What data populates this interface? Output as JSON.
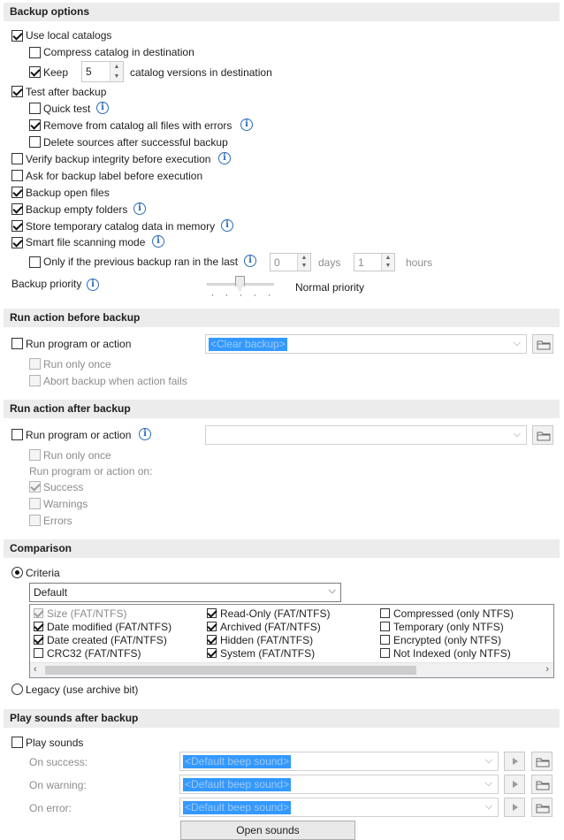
{
  "backup_options": {
    "header": "Backup options",
    "use_local_catalogs": {
      "label": "Use local catalogs",
      "checked": true
    },
    "compress_catalog": {
      "label": "Compress catalog in destination",
      "checked": false
    },
    "keep": {
      "label": "Keep",
      "value": "5",
      "suffix": "catalog versions in destination",
      "checked": true
    },
    "test_after_backup": {
      "label": "Test after backup",
      "checked": true
    },
    "quick_test": {
      "label": "Quick test",
      "checked": false
    },
    "remove_from_catalog": {
      "label": "Remove from catalog all files with errors",
      "checked": true
    },
    "delete_sources": {
      "label": "Delete sources after successful backup",
      "checked": false
    },
    "verify_integrity": {
      "label": "Verify backup integrity before execution",
      "checked": false
    },
    "ask_label": {
      "label": "Ask for backup label before execution",
      "checked": false
    },
    "backup_open_files": {
      "label": "Backup open files",
      "checked": true
    },
    "backup_empty_folders": {
      "label": "Backup empty folders",
      "checked": true
    },
    "store_temp": {
      "label": "Store temporary catalog data in memory",
      "checked": true
    },
    "smart_scan": {
      "label": "Smart file scanning mode",
      "checked": true
    },
    "only_if_previous": {
      "label": "Only if the previous backup ran in the last",
      "days_value": "0",
      "days_label": "days",
      "hours_value": "1",
      "hours_label": "hours",
      "checked": false
    },
    "priority": {
      "label": "Backup priority",
      "value_label": "Normal priority",
      "level": 0.5
    }
  },
  "before": {
    "header": "Run action before backup",
    "run_program": {
      "label": "Run program or action",
      "checked": false
    },
    "combo_value": "<Clear backup>",
    "run_only_once": {
      "label": "Run only once",
      "checked": false
    },
    "abort_on_fail": {
      "label": "Abort backup when action fails",
      "checked": false
    }
  },
  "after": {
    "header": "Run action after backup",
    "run_program": {
      "label": "Run program or action",
      "checked": false
    },
    "combo_value": "",
    "run_only_once": {
      "label": "Run only once",
      "checked": false
    },
    "run_on_label": "Run program or action on:",
    "success": {
      "label": "Success",
      "checked": true
    },
    "warnings": {
      "label": "Warnings",
      "checked": false
    },
    "errors": {
      "label": "Errors",
      "checked": false
    }
  },
  "comparison": {
    "header": "Comparison",
    "criteria_label": "Criteria",
    "criteria_selected": true,
    "dropdown_value": "Default",
    "items": [
      {
        "label": "Size (FAT/NTFS)",
        "checked": true,
        "disabled": true
      },
      {
        "label": "Read-Only (FAT/NTFS)",
        "checked": true,
        "disabled": false
      },
      {
        "label": "Compressed (only NTFS)",
        "checked": false,
        "disabled": false
      },
      {
        "label": "Date modified (FAT/NTFS)",
        "checked": true,
        "disabled": false
      },
      {
        "label": "Archived (FAT/NTFS)",
        "checked": true,
        "disabled": false
      },
      {
        "label": "Temporary (only NTFS)",
        "checked": false,
        "disabled": false
      },
      {
        "label": "Date created (FAT/NTFS)",
        "checked": true,
        "disabled": false
      },
      {
        "label": "Hidden (FAT/NTFS)",
        "checked": true,
        "disabled": false
      },
      {
        "label": "Encrypted (only NTFS)",
        "checked": false,
        "disabled": false
      },
      {
        "label": "CRC32 (FAT/NTFS)",
        "checked": false,
        "disabled": false
      },
      {
        "label": "System (FAT/NTFS)",
        "checked": true,
        "disabled": false
      },
      {
        "label": "Not Indexed (only NTFS)",
        "checked": false,
        "disabled": false
      }
    ],
    "legacy_label": "Legacy (use archive bit)"
  },
  "sounds": {
    "header": "Play sounds after backup",
    "play_sounds": {
      "label": "Play sounds",
      "checked": false
    },
    "on_success_label": "On success:",
    "on_warning_label": "On warning:",
    "on_error_label": "On error:",
    "default_sound": "<Default beep sound>",
    "open_sounds": "Open sounds"
  },
  "info_glyph": "i"
}
